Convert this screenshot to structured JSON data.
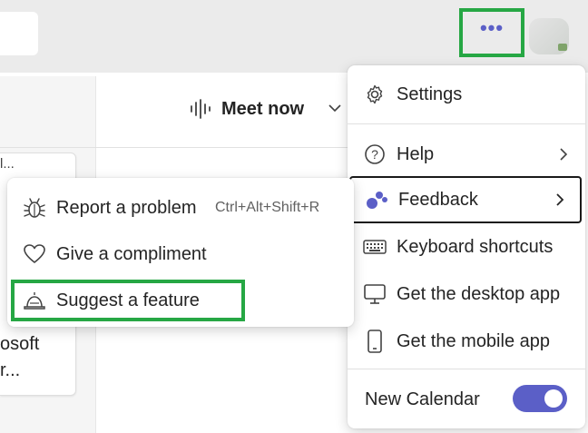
{
  "topbar": {
    "more_label": "•••"
  },
  "main": {
    "meet_now_label": "Meet now",
    "card_line1": "l...",
    "card_line2": "osoft",
    "card_line3": "r..."
  },
  "settings_menu": {
    "items": [
      {
        "label": "Settings",
        "icon": "gear-icon"
      },
      {
        "label": "Help",
        "icon": "help-icon"
      },
      {
        "label": "Feedback",
        "icon": "feedback-icon"
      },
      {
        "label": "Keyboard shortcuts",
        "icon": "keyboard-icon"
      },
      {
        "label": "Get the desktop app",
        "icon": "desktop-icon"
      },
      {
        "label": "Get the mobile app",
        "icon": "mobile-icon"
      }
    ],
    "new_calendar_label": "New Calendar",
    "new_calendar_on": true
  },
  "feedback_menu": {
    "items": [
      {
        "label": "Report a problem",
        "icon": "bug-icon",
        "shortcut": "Ctrl+Alt+Shift+R"
      },
      {
        "label": "Give a compliment",
        "icon": "heart-icon"
      },
      {
        "label": "Suggest a feature",
        "icon": "lamp-icon"
      }
    ]
  },
  "colors": {
    "accent": "#5b5fc7",
    "highlight_green": "#26a744"
  }
}
